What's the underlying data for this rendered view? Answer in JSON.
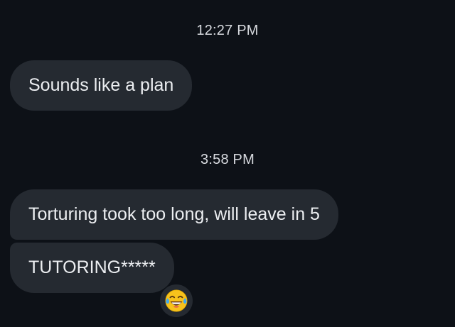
{
  "conversation": {
    "messages": [
      {
        "timestamp": "12:27 PM",
        "text": "Sounds like a plan"
      },
      {
        "timestamp": "3:58 PM",
        "text": "Torturing took too long, will leave in 5"
      },
      {
        "text": "TUTORING*****"
      }
    ],
    "reaction": {
      "icon": "face-with-tears-of-joy-icon"
    }
  },
  "colors": {
    "background": "#0d1117",
    "bubble": "#252a31",
    "text": "#eceef1"
  }
}
